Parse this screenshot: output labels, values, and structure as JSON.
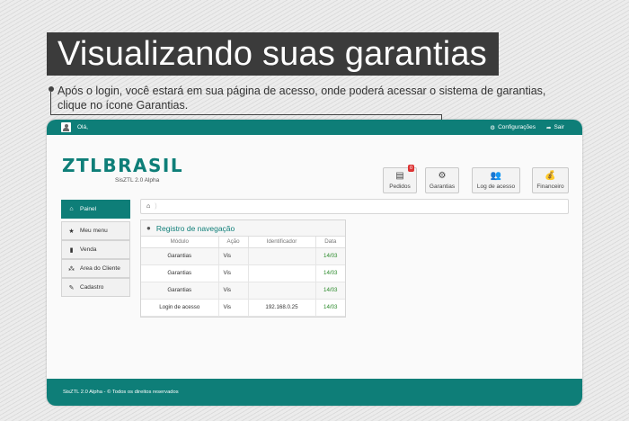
{
  "tutorial": {
    "title": "Visualizando suas garantias",
    "instruction_line1": "Após o login, você estará em sua página de acesso, onde poderá acessar o sistema de garantias,",
    "instruction_line2": "clique no ícone Garantias."
  },
  "topbar": {
    "greeting": "Olá,",
    "settings_label": "Configurações",
    "logout_label": "Sair"
  },
  "brand": {
    "logo": "ZTLBRASIL",
    "subtitle": "SisZTL 2.0 Alpha"
  },
  "nav": {
    "pedidos": "Pedidos",
    "pedidos_badge": "0",
    "garantias": "Garantias",
    "log": "Log de acesso",
    "financeiro": "Financeiro"
  },
  "sidebar": {
    "items": [
      {
        "label": "Painel",
        "icon": "home-icon"
      },
      {
        "label": "Meu menu",
        "icon": "star-icon"
      },
      {
        "label": "Venda",
        "icon": "document-icon"
      },
      {
        "label": "Area do Cliente",
        "icon": "sitemap-icon"
      },
      {
        "label": "Cadastro",
        "icon": "edit-icon"
      }
    ]
  },
  "panel": {
    "title": "Registro de navegação",
    "columns": [
      "Módulo",
      "Ação",
      "Identificador",
      "Data"
    ],
    "rows": [
      [
        "Garantias",
        "Vis",
        "",
        "14/03"
      ],
      [
        "Garantias",
        "Vis",
        "",
        "14/03"
      ],
      [
        "Garantias",
        "Vis",
        "",
        "14/03"
      ],
      [
        "Login de acesso",
        "Vis",
        "192.168.0.25",
        "14/03"
      ]
    ]
  },
  "footer": {
    "text": "SisZTL 2.0 Alpha - © Todos os direitos reservados"
  },
  "colors": {
    "accent": "#0e7e78",
    "date_green": "#2a8a2a",
    "badge_red": "#dd3333"
  }
}
